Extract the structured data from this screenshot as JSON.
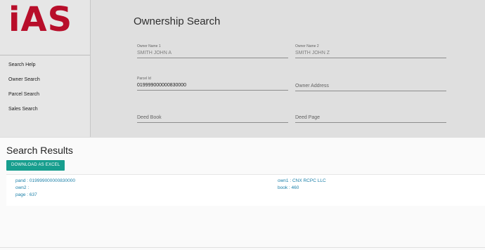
{
  "logo": {
    "text": "iAS"
  },
  "sidebar": {
    "items": [
      {
        "label": "Search Help"
      },
      {
        "label": "Owner Search"
      },
      {
        "label": "Parcel Search"
      },
      {
        "label": "Sales Search"
      }
    ]
  },
  "form": {
    "title": "Ownership Search",
    "owner_name_1": {
      "label": "Owner Name 1",
      "placeholder": "SMITH JOHN A"
    },
    "owner_name_2": {
      "label": "Owner Name 2",
      "placeholder": "SMITH JOHN Z"
    },
    "parcel_id": {
      "label": "Parcel Id",
      "value": "019999000000830000"
    },
    "owner_address": {
      "label": "Owner Address"
    },
    "deed_book": {
      "label": "Deed Book"
    },
    "deed_page": {
      "label": "Deed Page"
    }
  },
  "results": {
    "title": "Search Results",
    "download_label": "DOWNLOAD AS EXCEL",
    "rows": [
      {
        "pand": "pand : 019999000000830000",
        "own1": "own1 : CNX RCPC LLC",
        "own2": "own2 :",
        "book": "book : 460",
        "page": "page : 637"
      }
    ]
  },
  "colors": {
    "brand": "#c8102e",
    "accent": "#179e8e",
    "link": "#1a7fa8"
  }
}
